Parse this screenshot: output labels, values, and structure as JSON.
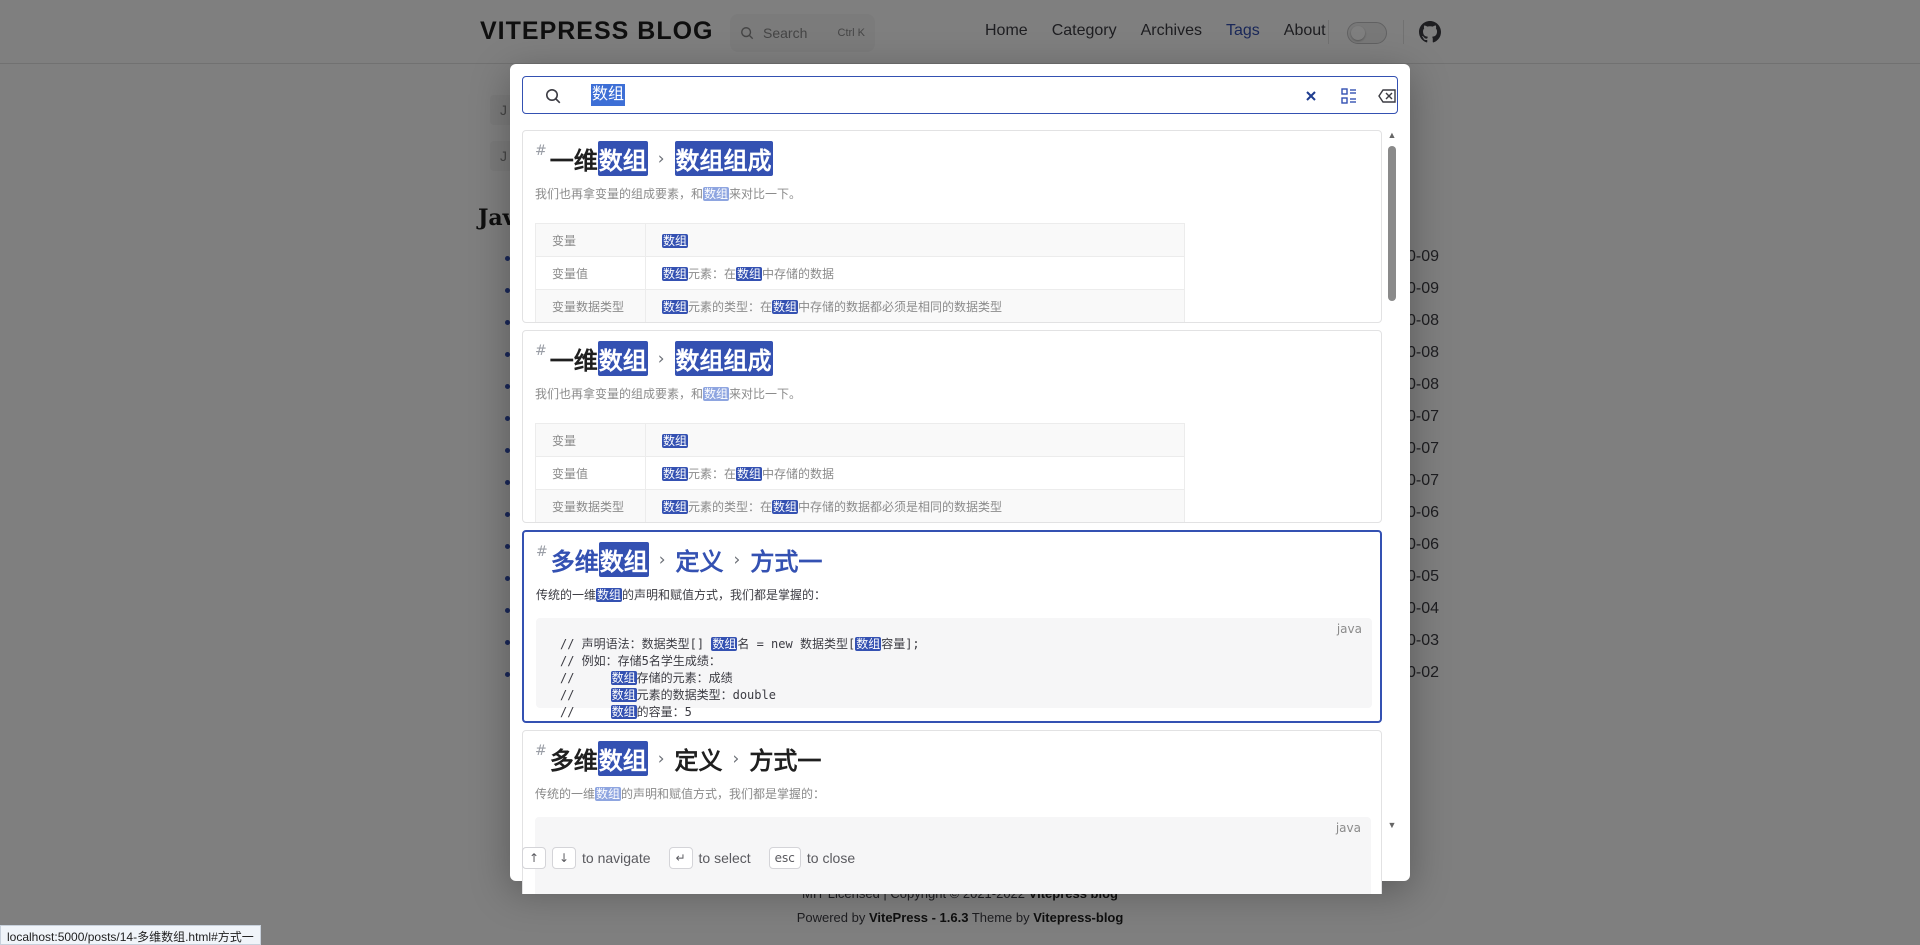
{
  "navbar": {
    "brand": "VITEPRESS BLOG",
    "search_label": "Search",
    "search_shortcut": "Ctrl K",
    "links": [
      "Home",
      "Category",
      "Archives",
      "Tags",
      "About"
    ],
    "active_link": "Tags"
  },
  "background": {
    "heading": "Jav",
    "dates": [
      "0-09",
      "0-09",
      "0-08",
      "0-08",
      "0-08",
      "0-07",
      "0-07",
      "0-07",
      "0-06",
      "0-06",
      "0-05",
      "0-04",
      "0-03",
      "0-02"
    ],
    "card_labels": [
      "J",
      "J"
    ]
  },
  "footer": {
    "license_prefix": "MIT Licensed | Copyright © 2021-2022 ",
    "license_name": "Vitepress blog",
    "powered_prefix": "Powered by ",
    "powered_vitepress": "VitePress - 1.6.3",
    "theme_text": " Theme by ",
    "theme_name": "Vitepress-blog"
  },
  "status_url": "localhost:5000/posts/14-多维数组.html#方式一",
  "search": {
    "query": "数组",
    "hint_navigate": "to navigate",
    "hint_select": "to select",
    "hint_close": "to close",
    "key_up": "↑",
    "key_down": "↓",
    "key_enter": "↵",
    "key_esc": "esc"
  },
  "results": [
    {
      "title_parts": [
        [
          "一维",
          "数组"
        ],
        [
          "数组组成"
        ]
      ],
      "excerpt": "我们也再拿变量的组成要素，和数组来对比一下。",
      "table": [
        [
          "变量",
          "数组"
        ],
        [
          "变量值",
          "数组元素：在数组中存储的数据"
        ],
        [
          "变量数据类型",
          "数组元素的类型：在数组中存储的数据都必须是相同的数据类型"
        ]
      ],
      "selected": false
    },
    {
      "title_parts": [
        [
          "一维",
          "数组"
        ],
        [
          "数组组成"
        ]
      ],
      "excerpt": "我们也再拿变量的组成要素，和数组来对比一下。",
      "table": [
        [
          "变量",
          "数组"
        ],
        [
          "变量值",
          "数组元素：在数组中存储的数据"
        ],
        [
          "变量数据类型",
          "数组元素的类型：在数组中存储的数据都必须是相同的数据类型"
        ]
      ],
      "selected": false
    },
    {
      "title_parts": [
        [
          "多维",
          "数组"
        ],
        [
          "定义"
        ],
        [
          "方式一"
        ]
      ],
      "excerpt": "传统的一维数组的声明和赋值方式，我们都是掌握的：",
      "code_lang": "java",
      "code_lines": [
        "// 声明语法：数据类型[] 数组名 = new 数据类型[数组容量];",
        "// 例如：存储5名学生成绩：",
        "//     数组存储的元素：成绩",
        "//     数组元素的数据类型：double",
        "//     数组的容量：5"
      ],
      "selected": true
    },
    {
      "title_parts": [
        [
          "多维",
          "数组"
        ],
        [
          "定义"
        ],
        [
          "方式一"
        ]
      ],
      "excerpt": "传统的一维数组的声明和赋值方式，我们都是掌握的：",
      "code_lang": "java",
      "selected": false
    }
  ],
  "colors": {
    "brand": "#3451b2",
    "highlight": "#3451b2",
    "overlay": "rgba(0,0,0,0.5)"
  }
}
